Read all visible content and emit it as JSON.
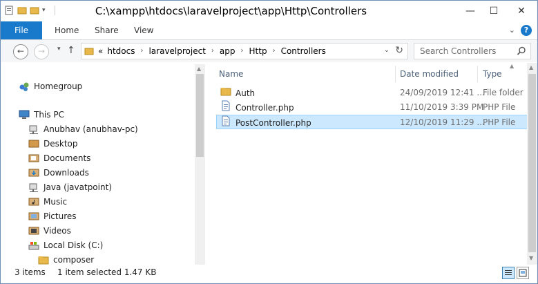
{
  "window": {
    "title": "C:\\xampp\\htdocs\\laravelproject\\app\\Http\\Controllers",
    "minimize": "—",
    "maximize": "☐",
    "close": "✕"
  },
  "ribbon": {
    "tabs": [
      "File",
      "Home",
      "Share",
      "View"
    ],
    "help": "?"
  },
  "address": {
    "prefix": "«",
    "crumbs": [
      "htdocs",
      "laravelproject",
      "app",
      "Http",
      "Controllers"
    ],
    "separator": "›"
  },
  "search": {
    "placeholder": "Search Controllers"
  },
  "nav_pane": {
    "items": [
      {
        "label": "Homegroup",
        "icon": "homegroup-icon"
      },
      {
        "label": "This PC",
        "icon": "pc-icon"
      },
      {
        "label": "Anubhav (anubhav-pc)",
        "icon": "network-drive-icon"
      },
      {
        "label": "Desktop",
        "icon": "desktop-icon"
      },
      {
        "label": "Documents",
        "icon": "documents-icon"
      },
      {
        "label": "Downloads",
        "icon": "downloads-icon"
      },
      {
        "label": "Java (javatpoint)",
        "icon": "network-drive-icon"
      },
      {
        "label": "Music",
        "icon": "music-icon"
      },
      {
        "label": "Pictures",
        "icon": "pictures-icon"
      },
      {
        "label": "Videos",
        "icon": "videos-icon"
      },
      {
        "label": "Local Disk (C:)",
        "icon": "local-disk-icon"
      },
      {
        "label": "composer",
        "icon": "folder-icon"
      }
    ]
  },
  "files": {
    "columns": [
      "Name",
      "Date modified",
      "Type"
    ],
    "rows": [
      {
        "name": "Auth",
        "date": "24/09/2019 12:41 ...",
        "type": "File folder",
        "icon": "folder-icon",
        "selected": false
      },
      {
        "name": "Controller.php",
        "date": "11/10/2019 3:39 PM",
        "type": "PHP File",
        "icon": "php-file-icon",
        "selected": false
      },
      {
        "name": "PostController.php",
        "date": "12/10/2019 11:29 ...",
        "type": "PHP File",
        "icon": "php-file-icon",
        "selected": true
      }
    ]
  },
  "status": {
    "count": "3 items",
    "selection": "1 item selected  1.47 KB"
  },
  "colors": {
    "accent": "#1979ca",
    "selection_bg": "#cce8ff",
    "selection_border": "#99d1ff",
    "folder": "#e8b94a"
  }
}
